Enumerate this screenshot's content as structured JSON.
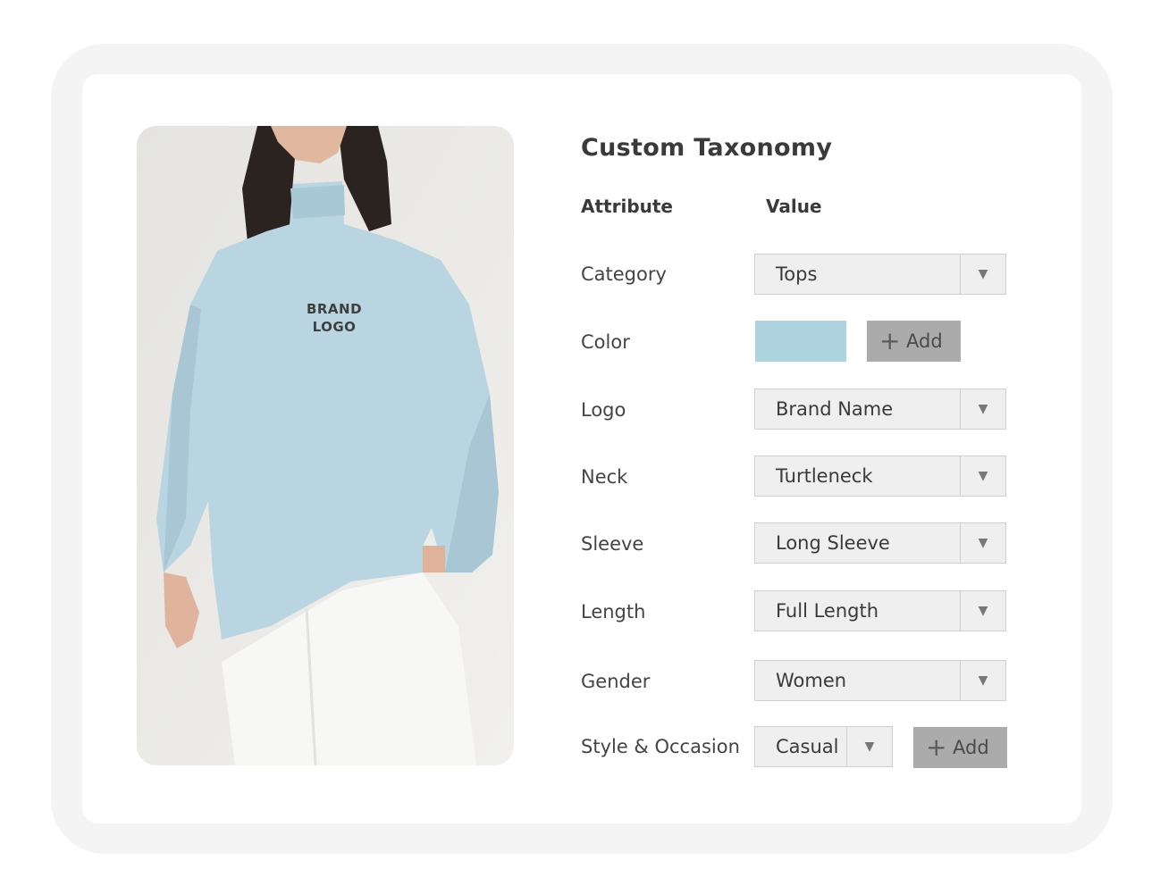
{
  "colors": {
    "frame": "#f4f4f4",
    "card": "#ffffff",
    "dropdown_bg": "#efefef",
    "add_button": "#ababab",
    "selected_color_swatch": "#add3df",
    "sweater": "#b9d5e1"
  },
  "photo": {
    "logo_line1": "BRAND",
    "logo_line2": "LOGO"
  },
  "panel": {
    "title": "Custom Taxonomy",
    "header_attribute": "Attribute",
    "header_value": "Value"
  },
  "rows": {
    "category": {
      "label": "Category",
      "value": "Tops"
    },
    "color": {
      "label": "Color",
      "add_label": "Add",
      "add_icon": "plus-icon"
    },
    "logo": {
      "label": "Logo",
      "value": "Brand Name"
    },
    "neck": {
      "label": "Neck",
      "value": "Turtleneck"
    },
    "sleeve": {
      "label": "Sleeve",
      "value": "Long Sleeve"
    },
    "length": {
      "label": "Length",
      "value": "Full Length"
    },
    "gender": {
      "label": "Gender",
      "value": "Women"
    },
    "style": {
      "label": "Style & Occasion",
      "value": "Casual",
      "add_label": "Add",
      "add_icon": "plus-icon"
    }
  },
  "icons": {
    "dropdown_arrow": "▼",
    "plus": "+"
  }
}
